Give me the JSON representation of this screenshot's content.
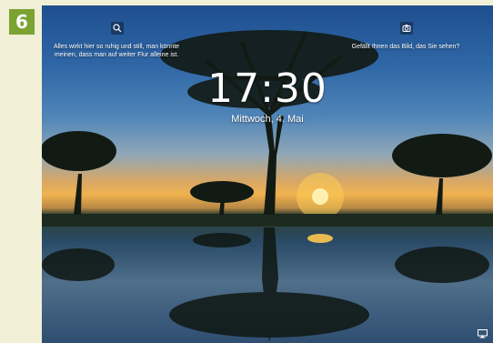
{
  "step": "6",
  "lockscreen": {
    "time": "17:30",
    "date": "Mittwoch, 4. Mai",
    "left_caption": "Alles wirkt hier so ruhig und still, man könnte meinen, dass man auf weiter Flur alleine ist.",
    "right_caption": "Gefällt Ihnen das Bild, das Sie sehen?"
  },
  "icons": {
    "left": "search-icon",
    "right": "camera-icon",
    "corner": "monitor-icon"
  },
  "colors": {
    "badge": "#7aa332",
    "page_background": "#f1efd6"
  }
}
